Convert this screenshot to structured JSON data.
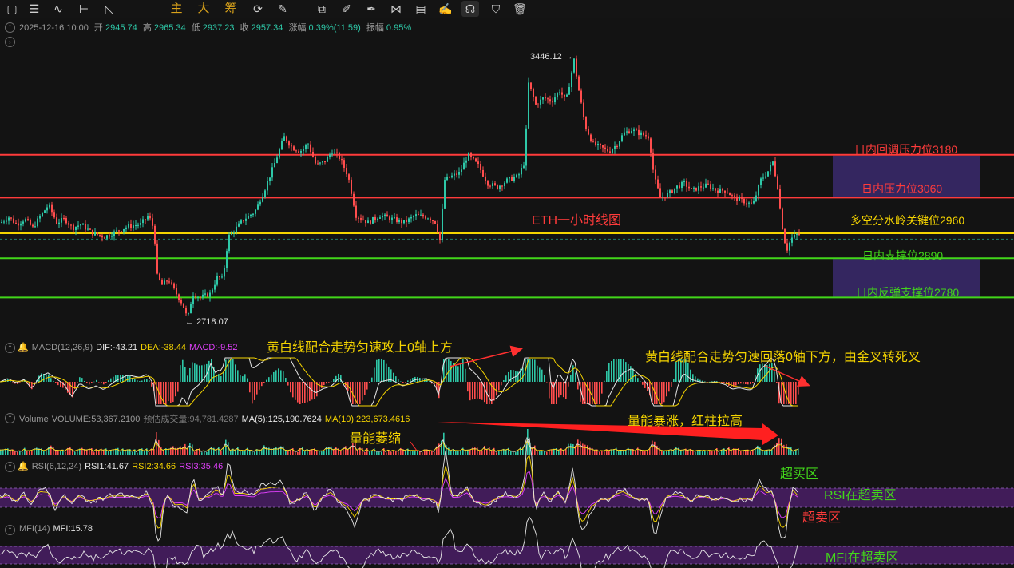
{
  "toolbar": {
    "tools": [
      "square-icon",
      "menu-icon",
      "indicator-icon",
      "horizontal-line-icon",
      "angle-icon",
      "主",
      "大",
      "筹",
      "replay-icon",
      "brush-tools-icon",
      "copy-icon",
      "pen-icon",
      "highlighter-icon",
      "pattern-icon",
      "clipboard-icon",
      "edit-icon",
      "magnet-icon",
      "filter-icon",
      "trash-icon"
    ]
  },
  "ohlc": {
    "date": "2025-12-16 10:00",
    "open_label": "开",
    "open": "2945.74",
    "high_label": "高",
    "high": "2965.34",
    "low_label": "低",
    "low": "2937.23",
    "close_label": "收",
    "close": "2957.34",
    "change_label": "涨幅",
    "change": "0.39%(11.59)",
    "amp_label": "振幅",
    "amp": "0.95%"
  },
  "main_chart": {
    "title": "ETH一小时线图",
    "high_marker": "3446.12",
    "low_marker": "2718.07",
    "levels": [
      {
        "label": "日内回调压力位3180",
        "value": 3180,
        "color": "#ff3b3b"
      },
      {
        "label": "日内压力位3060",
        "value": 3060,
        "color": "#ff3b3b"
      },
      {
        "label": "多空分水岭关键位2960",
        "value": 2960,
        "color": "#f5d400"
      },
      {
        "label": "日内支撑位2890",
        "value": 2890,
        "color": "#42d61a"
      },
      {
        "label": "日内反弹支撑位2780",
        "value": 2780,
        "color": "#42d61a"
      }
    ]
  },
  "macd": {
    "name": "MACD(12,26,9)",
    "dif": "DIF:-43.21",
    "dea": "DEA:-38.44",
    "macd": "MACD:-9.52",
    "note_up": "黄白线配合走势匀速攻上0轴上方",
    "note_down": "黄白线配合走势匀速回落0轴下方，由金叉转死叉"
  },
  "volume": {
    "name": "Volume",
    "vol": "VOLUME:53,367.2100",
    "est": "预估成交量:94,781.4287",
    "ma5": "MA(5):125,190.7624",
    "ma10": "MA(10):223,673.4616",
    "note_shrink": "量能萎缩",
    "note_surge": "量能暴涨，红柱拉高"
  },
  "rsi": {
    "name": "RSI(6,12,24)",
    "rsi1": "RSI1:41.67",
    "rsi2": "RSI2:34.66",
    "rsi3": "RSI3:35.46",
    "note_overbought": "超买区",
    "note_zone": "RSI在超卖区",
    "note_oversold": "超卖区"
  },
  "mfi": {
    "name": "MFI(14)",
    "value": "MFI:15.78",
    "note": "MFI在超卖区"
  },
  "chart_data": {
    "type": "candlestick",
    "title": "ETH一小时线图",
    "price_range": [
      2718.07,
      3446.12
    ],
    "price_path": [
      [
        0,
        2990
      ],
      [
        10,
        3005
      ],
      [
        20,
        2985
      ],
      [
        30,
        3000
      ],
      [
        40,
        2975
      ],
      [
        50,
        3010
      ],
      [
        60,
        3040
      ],
      [
        70,
        2990
      ],
      [
        80,
        3000
      ],
      [
        90,
        2975
      ],
      [
        100,
        2985
      ],
      [
        115,
        2960
      ],
      [
        130,
        2950
      ],
      [
        145,
        2965
      ],
      [
        160,
        2980
      ],
      [
        175,
        2985
      ],
      [
        185,
        3010
      ],
      [
        192,
        2970
      ],
      [
        196,
        2840
      ],
      [
        202,
        2815
      ],
      [
        210,
        2830
      ],
      [
        220,
        2790
      ],
      [
        228,
        2760
      ],
      [
        234,
        2718
      ],
      [
        240,
        2790
      ],
      [
        250,
        2780
      ],
      [
        262,
        2790
      ],
      [
        272,
        2840
      ],
      [
        278,
        2830
      ],
      [
        285,
        2950
      ],
      [
        295,
        2975
      ],
      [
        305,
        3000
      ],
      [
        318,
        3020
      ],
      [
        330,
        3080
      ],
      [
        342,
        3150
      ],
      [
        355,
        3230
      ],
      [
        365,
        3200
      ],
      [
        375,
        3190
      ],
      [
        385,
        3210
      ],
      [
        395,
        3150
      ],
      [
        405,
        3160
      ],
      [
        415,
        3190
      ],
      [
        425,
        3170
      ],
      [
        435,
        3120
      ],
      [
        445,
        3010
      ],
      [
        460,
        2990
      ],
      [
        475,
        3010
      ],
      [
        490,
        3000
      ],
      [
        505,
        2990
      ],
      [
        520,
        3010
      ],
      [
        535,
        3005
      ],
      [
        545,
        2990
      ],
      [
        550,
        2940
      ],
      [
        556,
        3110
      ],
      [
        565,
        3120
      ],
      [
        575,
        3130
      ],
      [
        585,
        3180
      ],
      [
        598,
        3150
      ],
      [
        610,
        3100
      ],
      [
        622,
        3090
      ],
      [
        635,
        3110
      ],
      [
        648,
        3120
      ],
      [
        656,
        3160
      ],
      [
        661,
        3380
      ],
      [
        670,
        3320
      ],
      [
        680,
        3340
      ],
      [
        690,
        3330
      ],
      [
        700,
        3360
      ],
      [
        708,
        3330
      ],
      [
        714,
        3400
      ],
      [
        718,
        3446
      ],
      [
        724,
        3360
      ],
      [
        732,
        3260
      ],
      [
        742,
        3210
      ],
      [
        752,
        3200
      ],
      [
        762,
        3190
      ],
      [
        772,
        3210
      ],
      [
        780,
        3240
      ],
      [
        790,
        3250
      ],
      [
        800,
        3240
      ],
      [
        812,
        3230
      ],
      [
        818,
        3120
      ],
      [
        826,
        3060
      ],
      [
        836,
        3070
      ],
      [
        846,
        3090
      ],
      [
        856,
        3100
      ],
      [
        866,
        3080
      ],
      [
        876,
        3090
      ],
      [
        886,
        3095
      ],
      [
        896,
        3080
      ],
      [
        908,
        3080
      ],
      [
        918,
        3060
      ],
      [
        930,
        3050
      ],
      [
        942,
        3040
      ],
      [
        952,
        3110
      ],
      [
        960,
        3130
      ],
      [
        967,
        3160
      ],
      [
        973,
        3090
      ],
      [
        978,
        2990
      ],
      [
        984,
        2910
      ],
      [
        990,
        2945
      ],
      [
        998,
        2957
      ]
    ],
    "x_range": [
      0,
      1000
    ]
  }
}
